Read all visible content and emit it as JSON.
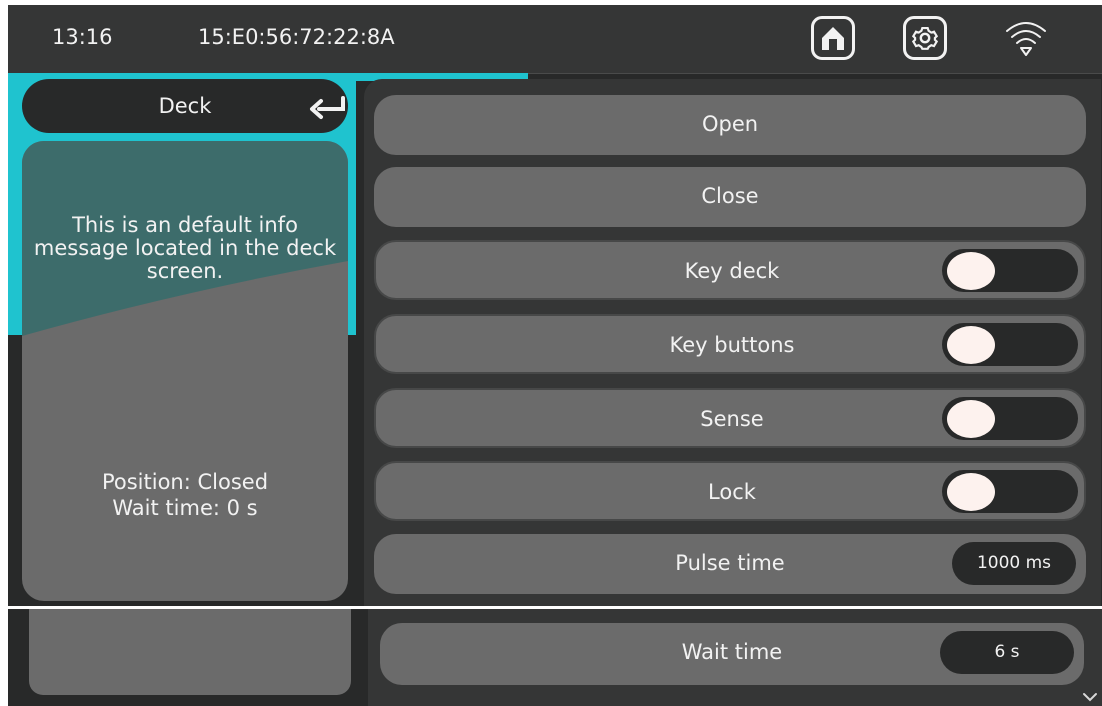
{
  "status_bar": {
    "time": "13:16",
    "mac_address": "15:E0:56:72:22:8A",
    "icons": [
      "home-icon",
      "gear-icon",
      "wifi-icon"
    ]
  },
  "deck": {
    "title": "Deck",
    "back_icon": "return-arrow-icon",
    "info_message": "This is an default info message located in the deck screen.",
    "position_line": "Position: Closed",
    "wait_time_line": "Wait time: 0 s"
  },
  "actions": {
    "open_label": "Open",
    "close_label": "Close"
  },
  "toggles": [
    {
      "label": "Key deck",
      "state": "off"
    },
    {
      "label": "Key buttons",
      "state": "off"
    },
    {
      "label": "Sense",
      "state": "off"
    },
    {
      "label": "Lock",
      "state": "off"
    }
  ],
  "settings": [
    {
      "label": "Pulse time",
      "value": "1000 ms"
    },
    {
      "label": "Wait time",
      "value": "6 s"
    }
  ],
  "colors": {
    "accent": "#1fc3cf",
    "background": "#282929",
    "card": "#6b6b6b",
    "knob": "#fdf2ee"
  }
}
